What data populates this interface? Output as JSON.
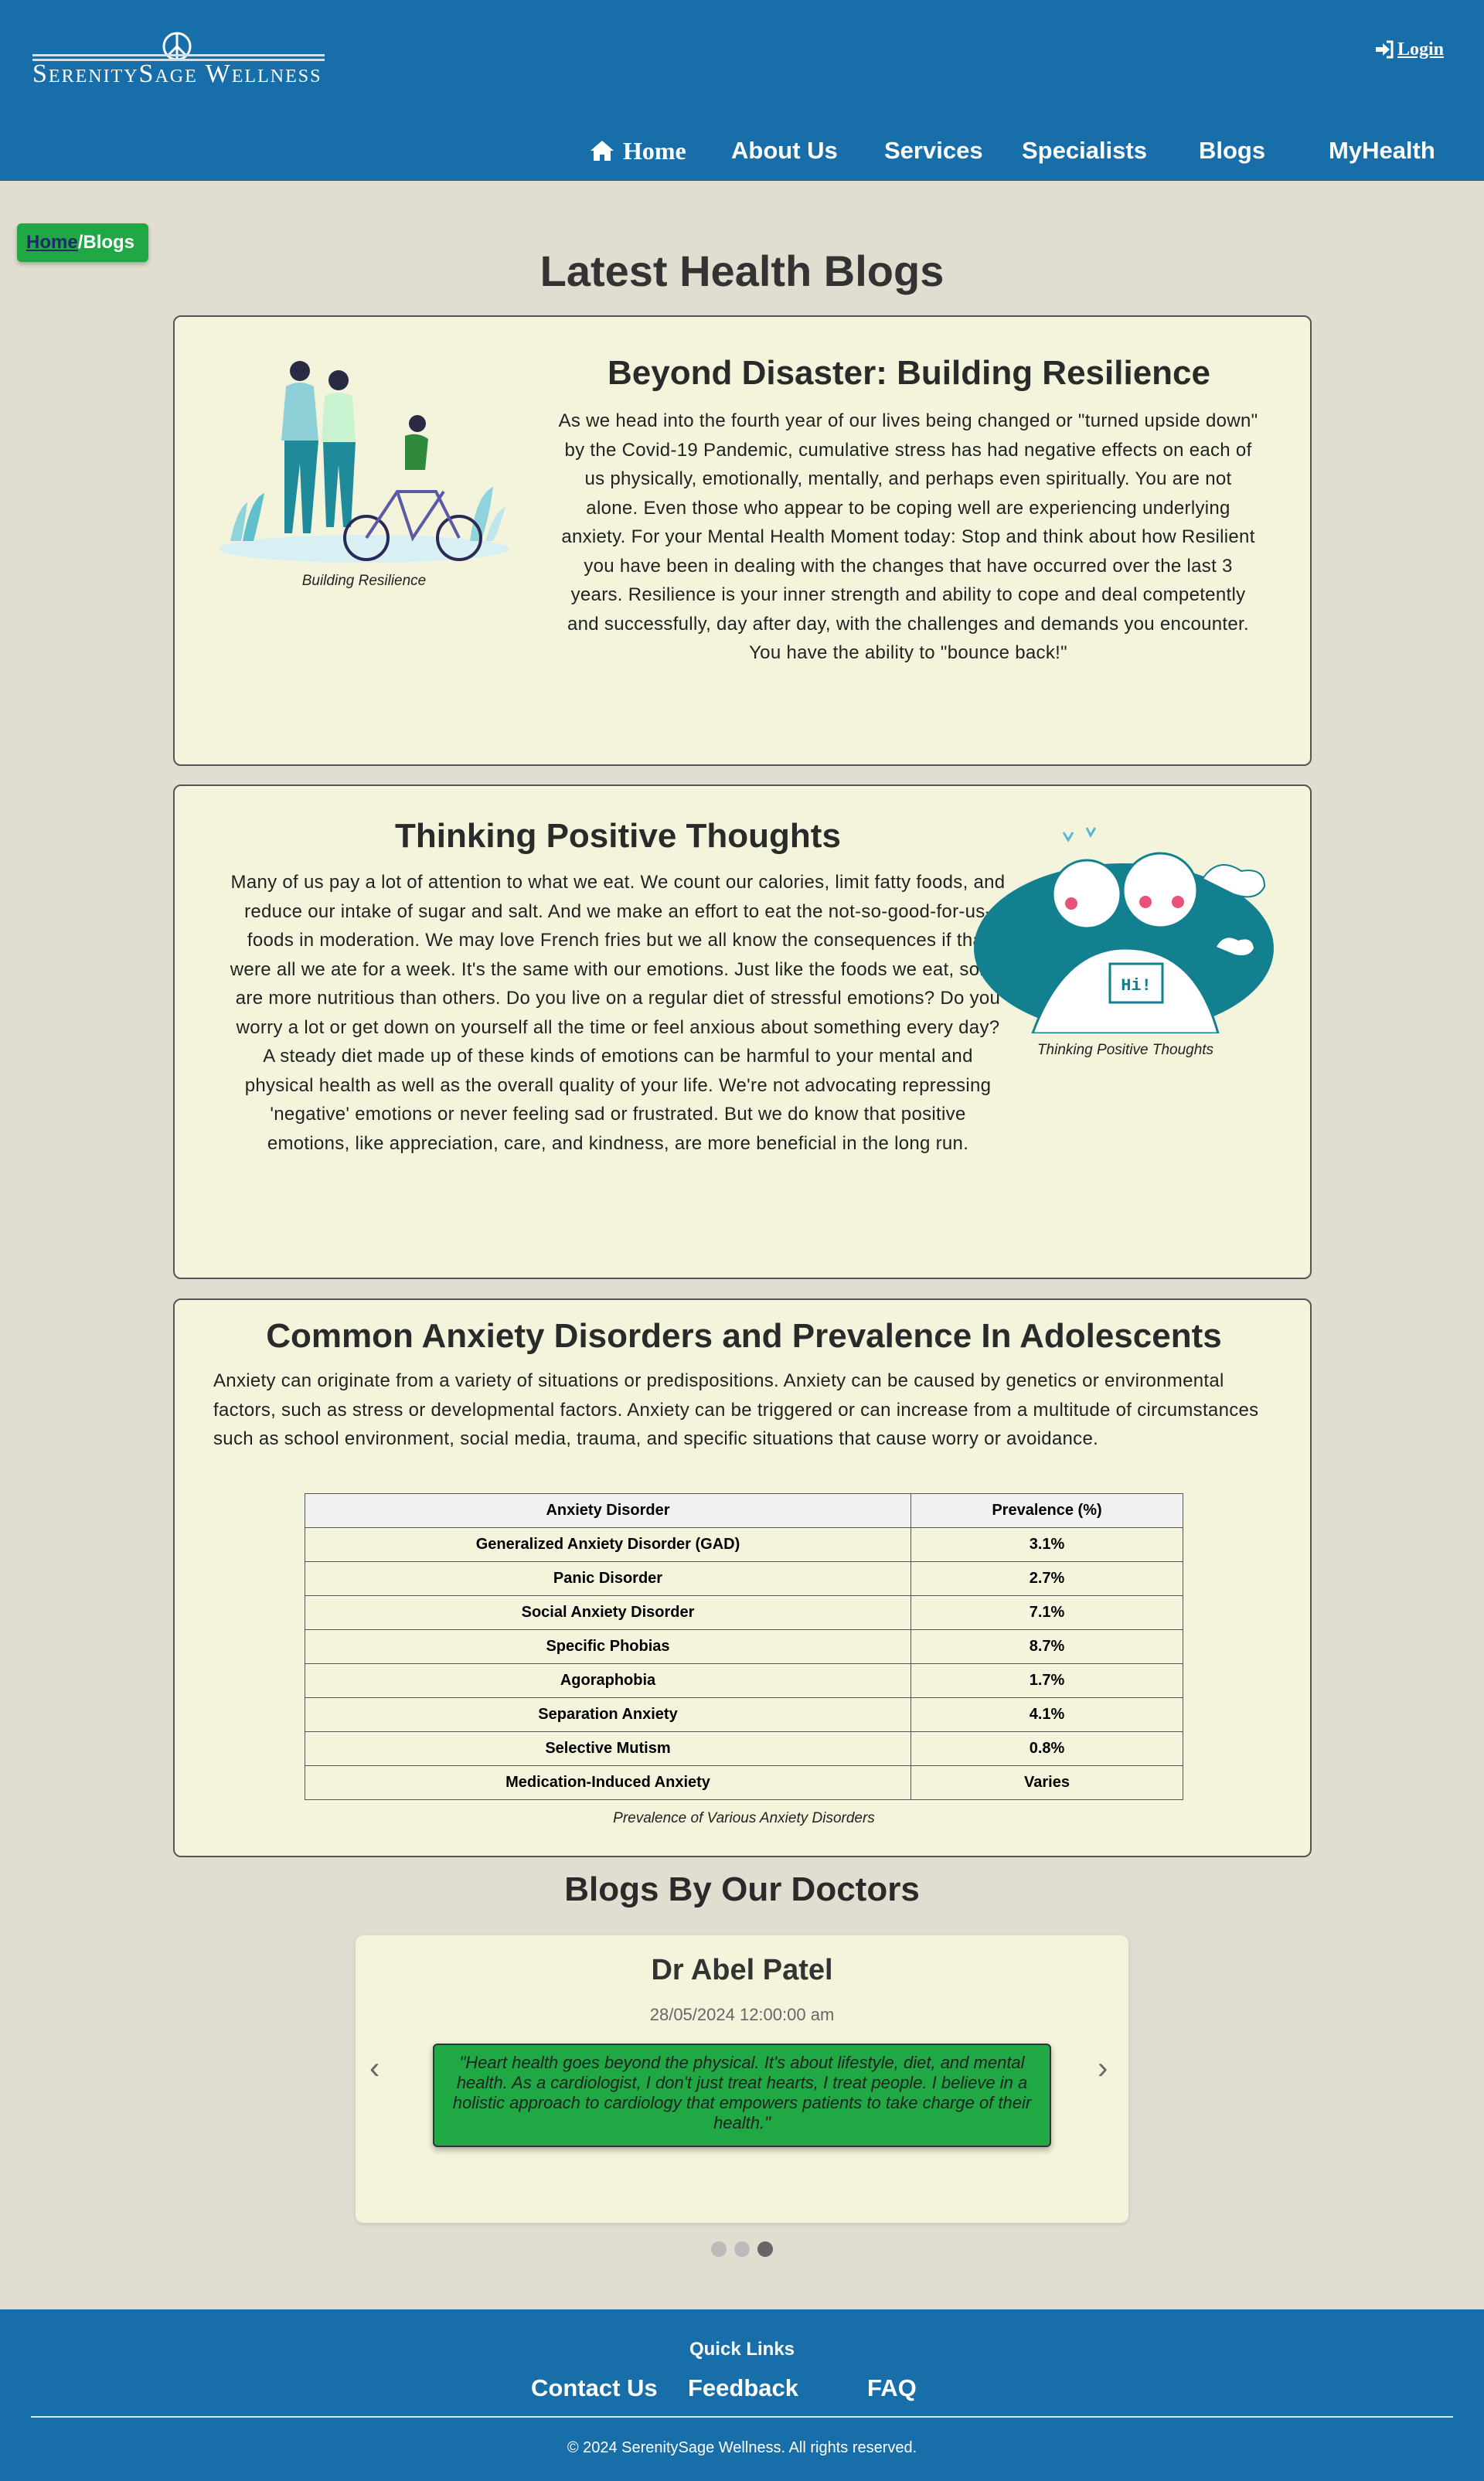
{
  "header": {
    "logo_text": "SerenitySage Wellness",
    "login_label": "Login",
    "nav": {
      "home": "Home",
      "about": "About Us",
      "services": "Services",
      "specialists": "Specialists",
      "blogs": "Blogs",
      "myhealth": "MyHealth"
    }
  },
  "breadcrumb": {
    "home": "Home",
    "separator": " /",
    "current": "Blogs"
  },
  "page_title": "Latest Health Blogs",
  "blogs": [
    {
      "title": "Beyond Disaster: Building Resilience",
      "image_caption": "Building Resilience",
      "body": "As we head into the fourth year of our lives being changed or \"turned upside down\" by the Covid-19 Pandemic, cumulative stress has had negative effects on each of us physically, emotionally, mentally, and perhaps even spiritually. You are not alone. Even those who appear to be coping well are experiencing underlying anxiety. For your Mental Health Moment today: Stop and think about how Resilient you have been in dealing with the changes that have occurred over the last 3 years. Resilience is your inner strength and ability to cope and deal competently and successfully, day after day, with the challenges and demands you encounter. You have the ability to \"bounce back!\""
    },
    {
      "title": "Thinking Positive Thoughts",
      "image_caption": "Thinking Positive Thoughts",
      "image_text": "Hi!",
      "body": "Many of us pay a lot of attention to what we eat. We count our calories, limit fatty foods, and reduce our intake of sugar and salt. And we make an effort to eat the not-so-good-for-us-foods in moderation. We may love French fries but we all know the consequences if that were all we ate for a week. It's the same with our emotions. Just like the foods we eat, some are more nutritious than others. Do you live on a regular diet of stressful emotions? Do you worry a lot or get down on yourself all the time or feel anxious about something every day? A steady diet made up of these kinds of emotions can be harmful to your mental and physical health as well as the overall quality of your life. We're not advocating repressing 'negative' emotions or never feeling sad or frustrated. But we do know that positive emotions, like appreciation, care, and kindness, are more beneficial in the long run."
    }
  ],
  "anxiety": {
    "title": "Common Anxiety Disorders and Prevalence In Adolescents",
    "intro": "Anxiety can originate from a variety of situations or predispositions. Anxiety can be caused by genetics or environmental factors, such as stress or developmental factors. Anxiety can be triggered or can increase from a multitude of circumstances such as school environment, social media, trauma, and specific situations that cause worry or avoidance.",
    "headers": [
      "Anxiety Disorder",
      "Prevalence (%)"
    ],
    "rows": [
      [
        "Generalized Anxiety Disorder (GAD)",
        "3.1%"
      ],
      [
        "Panic Disorder",
        "2.7%"
      ],
      [
        "Social Anxiety Disorder",
        "7.1%"
      ],
      [
        "Specific Phobias",
        "8.7%"
      ],
      [
        "Agoraphobia",
        "1.7%"
      ],
      [
        "Separation Anxiety",
        "4.1%"
      ],
      [
        "Selective Mutism",
        "0.8%"
      ],
      [
        "Medication-Induced Anxiety",
        "Varies"
      ]
    ],
    "caption": "Prevalence of Various Anxiety Disorders"
  },
  "doctors": {
    "title": "Blogs By Our Doctors",
    "name": "Dr Abel Patel",
    "date": "28/05/2024 12:00:00 am",
    "quote": "\"Heart health goes beyond the physical. It's about lifestyle, diet, and mental health. As a cardiologist, I don't just treat hearts, I treat people. I believe in a holistic approach to cardiology that empowers patients to take charge of their health.\"",
    "prev": "‹",
    "next": "›",
    "slides_total": 3,
    "active_slide": 3
  },
  "footer": {
    "quick_links_title": "Quick Links",
    "links": [
      "Contact Us",
      "Feedback",
      "FAQ"
    ],
    "copyright": "© 2024 SerenitySage Wellness. All rights reserved."
  },
  "colors": {
    "header_bg": "#186ea8",
    "page_bg": "#e2ddd1",
    "card_bg": "#f4f4dc",
    "accent_green": "#1fa843",
    "teal": "#13808f"
  }
}
